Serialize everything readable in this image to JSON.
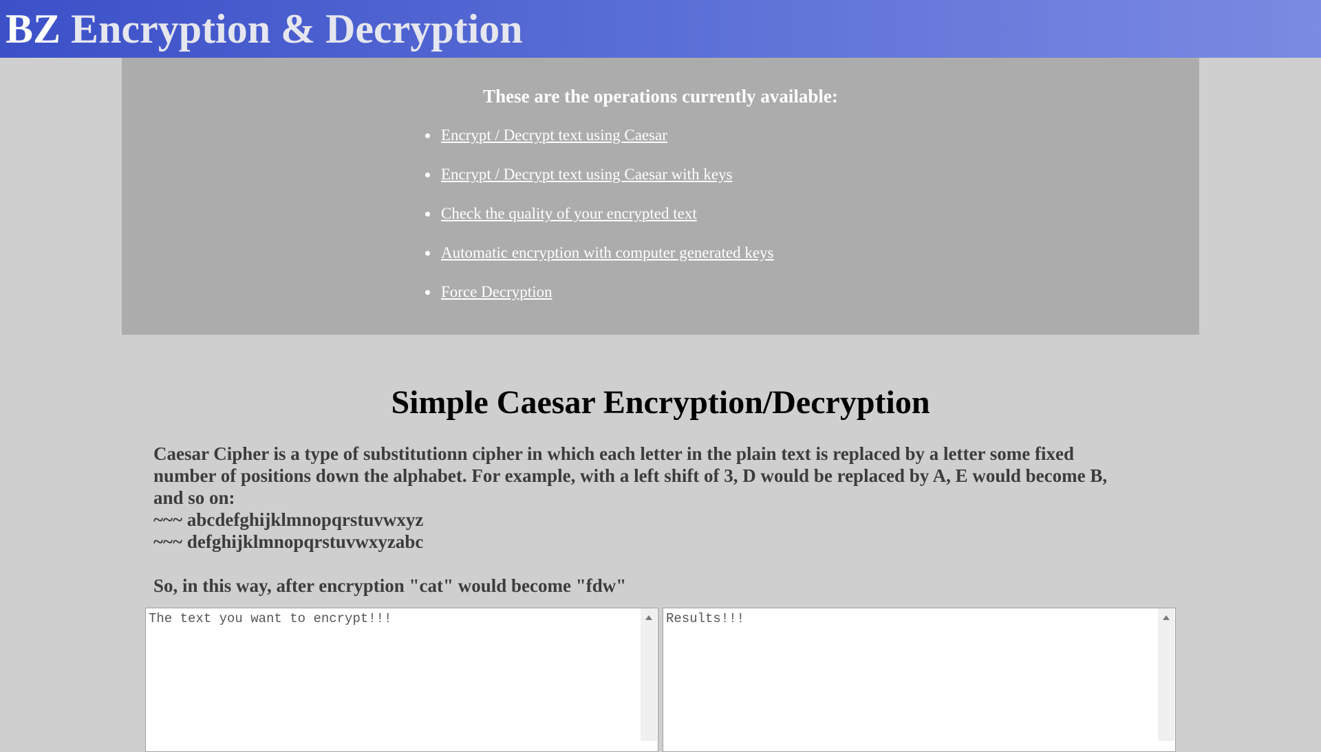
{
  "header": {
    "title_bz": "BZ",
    "title_rest": "Encryption & Decryption"
  },
  "operations": {
    "heading": "These are the operations currently available:",
    "items": [
      {
        "label": "Encrypt / Decrypt text using Caesar"
      },
      {
        "label": "Encrypt / Decrypt text using Caesar with keys"
      },
      {
        "label": "Check the quality of your encrypted text"
      },
      {
        "label": "Automatic encryption with computer generated keys"
      },
      {
        "label": "Force Decryption"
      }
    ]
  },
  "main": {
    "title": "Simple Caesar Encryption/Decryption",
    "description_lines": [
      "Caesar Cipher is a type of substitutionn cipher in which each letter in the plain text is replaced by a letter some fixed",
      "number of positions down the alphabet. For example, with a left shift of 3, D would be replaced by A, E would become B,",
      "and so on:",
      "~~~ abcdefghijklmnopqrstuvwxyz",
      "~~~ defghijklmnopqrstuvwxyzabc"
    ],
    "example": "So, in this way, after encryption \"cat\" would become \"fdw\""
  },
  "editor": {
    "input_placeholder": "The text you want to encrypt!!!",
    "output_placeholder": "Results!!!"
  },
  "colors": {
    "header_gradient_start": "#3c50c8",
    "header_gradient_end": "#7b8ae2",
    "panel_background": "#acacac",
    "page_background": "#cfcfcf"
  }
}
